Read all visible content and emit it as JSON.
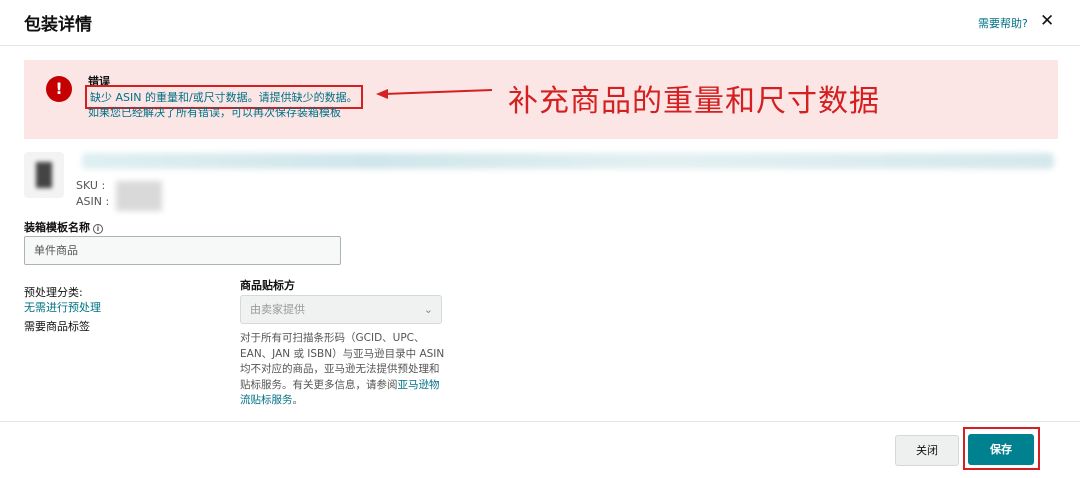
{
  "header": {
    "title": "包装详情",
    "help_link": "需要帮助?",
    "close_glyph": "✕"
  },
  "alert": {
    "icon_glyph": "!",
    "heading": "错误",
    "message": "缺少 ASIN 的重量和/或尺寸数据。请提供缺少的数据。",
    "hint": "如果您已经解决了所有错误，可以再次保存装箱模板",
    "annotation": "补充商品的重量和尺寸数据",
    "colors": {
      "background": "#fbe5e5",
      "icon": "#c40000",
      "annotation": "#d42020",
      "link": "#007185"
    }
  },
  "product": {
    "sku_label": "SKU :",
    "asin_label": "ASIN :"
  },
  "template": {
    "label": "装箱模板名称",
    "info_glyph": "i",
    "value": "单件商品"
  },
  "prep": {
    "label": "预处理分类:",
    "link": "无需进行预处理",
    "note": "需要商品标签"
  },
  "labeling": {
    "label": "商品贴标方",
    "selected": "由卖家提供",
    "description": "对于所有可扫描条形码（GCID、UPC、EAN、JAN 或 ISBN）与亚马逊目录中 ASIN 均不对应的商品，亚马逊无法提供预处理和贴标服务。有关更多信息，请参阅",
    "description_link": "亚马逊物流贴标服务",
    "description_end": "。"
  },
  "footer": {
    "close_label": "关闭",
    "save_label": "保存",
    "colors": {
      "save": "#00818f",
      "highlight": "#d42020"
    }
  }
}
